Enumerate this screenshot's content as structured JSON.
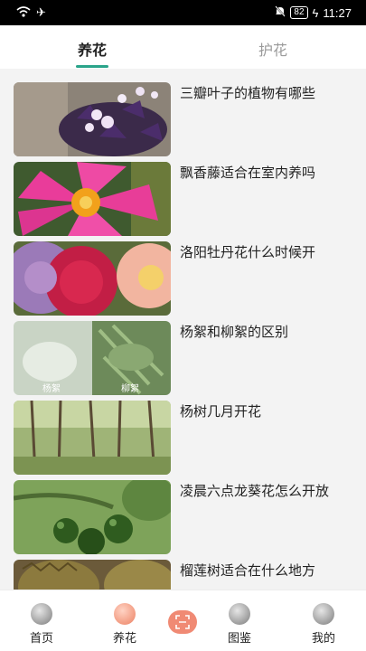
{
  "status": {
    "time": "11:27",
    "battery": "82"
  },
  "tabs": [
    {
      "label": "养花",
      "active": true
    },
    {
      "label": "护花",
      "active": false
    }
  ],
  "accent_color": "#2aa48a",
  "articles": [
    {
      "title": "三瓣叶子的植物有哪些",
      "icon": "purple-shamrock-photo"
    },
    {
      "title": "飘香藤适合在室内养吗",
      "icon": "pink-mandevilla-photo"
    },
    {
      "title": "洛阳牡丹花什么时候开",
      "icon": "peony-photo"
    },
    {
      "title": "杨絮和柳絮的区别",
      "icon": "poplar-willow-photo",
      "captions": [
        "杨絮",
        "柳絮"
      ]
    },
    {
      "title": "杨树几月开花",
      "icon": "poplar-forest-photo"
    },
    {
      "title": "凌晨六点龙葵花怎么开放",
      "icon": "nightshade-berries-photo"
    },
    {
      "title": "榴莲树适合在什么地方",
      "icon": "durian-photo"
    }
  ],
  "bottom_nav": [
    {
      "label": "首页",
      "icon": "home-icon"
    },
    {
      "label": "养花",
      "icon": "flower-icon",
      "active": true
    },
    {
      "label": "",
      "icon": "scan-icon"
    },
    {
      "label": "图鉴",
      "icon": "guide-icon"
    },
    {
      "label": "我的",
      "icon": "profile-icon"
    }
  ]
}
